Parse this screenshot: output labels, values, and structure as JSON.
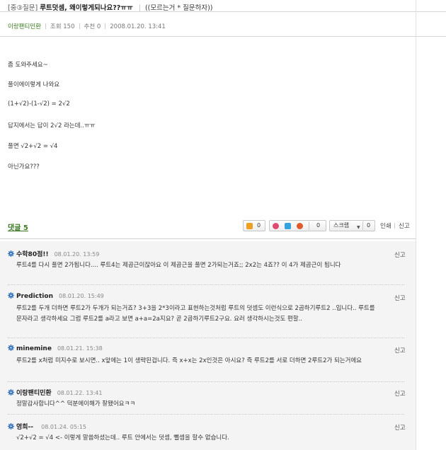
{
  "post": {
    "category": "[중③질문]",
    "title": "루트덧셈, 왜이렇게되나요??ㅠㅠ",
    "board": "((모르는거 * 질문하자))",
    "author": "이랑팬티민환",
    "views_label": "조회 150",
    "recommend_label": "추천 0",
    "datetime": "2008.01.20. 13:41",
    "lines": [
      "좀 도와주세요~",
      "풀이에이렇게 나와요",
      "(1+√2)-(1-√2) = 2√2",
      "답지에서는 답이 2√2 라는데..ㅠㅠ",
      "풀면 √2+√2 = √4",
      "아닌가요???"
    ]
  },
  "toolbar": {
    "reply_count": "댓글 5",
    "like_count": "0",
    "share_count": "0",
    "scrap_label": "스크랩",
    "scrap_count": "0",
    "print_label": "인쇄",
    "report_label": "신고"
  },
  "comments": [
    {
      "nick": "수학80점!!",
      "date": "08.01.20. 13:59",
      "report": "신고",
      "text": "루트4를 다시 풀면 2가됩니다.... 루트4는 제곱근이잖아요 이 제곱근을 풀면 2가되는거죠;; 2x2는 4죠?? 이 4가 제곱근이 됩니다"
    },
    {
      "nick": "Prediction",
      "date": "08.01.20. 15:49",
      "report": "신고",
      "text": "루트2를 두개 더하면 루트2가 두개가 되는거죠? 3+3을 2*3이라고 표현하는것처럼 루트의 덧셈도 이런식으로 2곱하기루트2 ..입니다.. 루트를 문자라고 생각하세요 그럼 루트2를 a라고 보면 a+a=2a지요? 곧 2곱하기루트2구요. 요러 생각하시는것도 편할.."
    },
    {
      "nick": "minemine",
      "date": "08.01.21. 15:38",
      "report": "신고",
      "text": "루트2를 x처럼 미지수로 보시면.. x앞에는 1이 생략된겁니다. 즉 x+x는 2x인것은 아시요? 즉 루트2를 서로 더하면 2루트2가 되는거에요"
    },
    {
      "nick": "이랑팬티민환",
      "date": "08.01.22. 13:41",
      "report": "신고",
      "text": "정말감사합니다^^ 덕분에이해가 잘됐어요ㅋㅋ"
    },
    {
      "nick": "영희-- ",
      "date": "08.01.24. 05:15",
      "report": "신고",
      "text": "√2+√2 = √4 <- 이렇게 말씀하셨는데.. 루트 안에서는 덧셈, 뺄셈을 할수 없습니다."
    }
  ],
  "colors": {
    "accent_green": "#3b7a22",
    "comment_bg": "#f4f4f4",
    "gear_blue": "#2f6fb8"
  }
}
